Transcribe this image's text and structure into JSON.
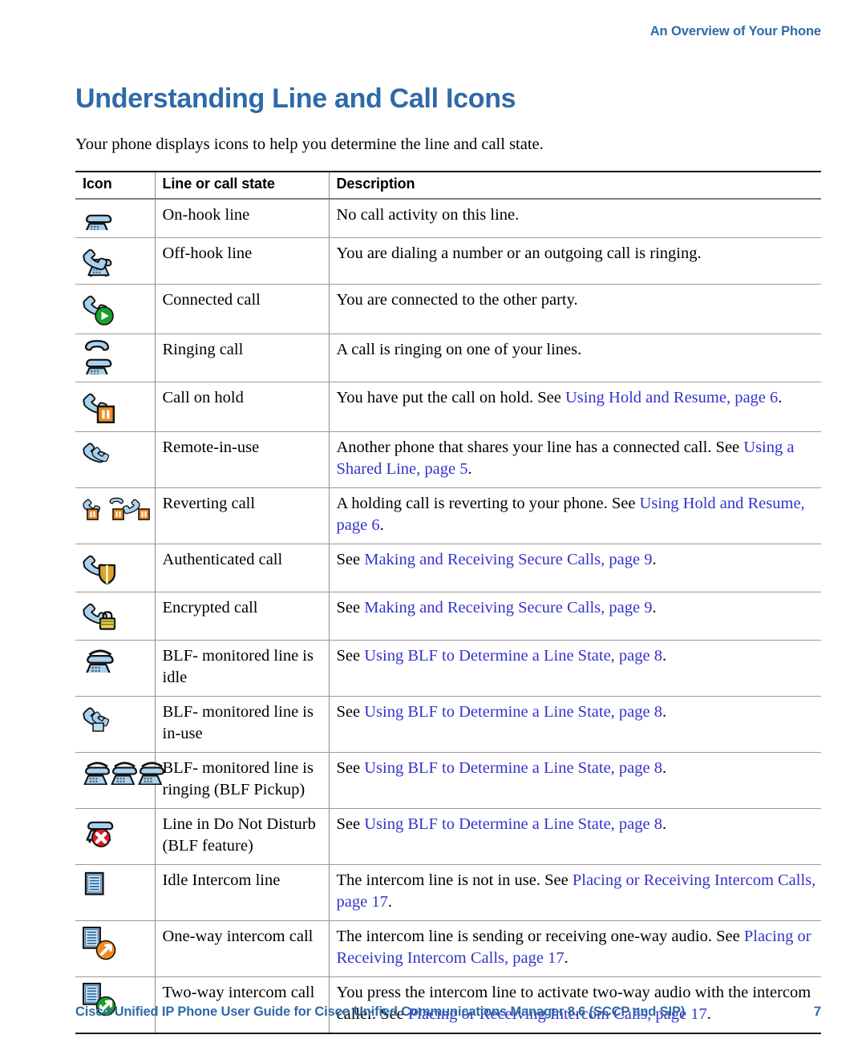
{
  "header": {
    "running_head": "An Overview of Your Phone"
  },
  "page": {
    "title": "Understanding Line and Call Icons",
    "intro": "Your phone displays icons to help you determine the line and call state."
  },
  "table": {
    "columns": [
      "Icon",
      "Line or call state",
      "Description"
    ],
    "rows": [
      {
        "icon": "on-hook-line-icon",
        "state": "On-hook line",
        "description_parts": [
          {
            "text": "No call activity on this line.",
            "link": false
          }
        ]
      },
      {
        "icon": "off-hook-line-icon",
        "state": "Off-hook line",
        "description_parts": [
          {
            "text": "You are dialing a number or an outgoing call is ringing.",
            "link": false
          }
        ]
      },
      {
        "icon": "connected-call-icon",
        "state": "Connected call",
        "description_parts": [
          {
            "text": "You are connected to the other party.",
            "link": false
          }
        ]
      },
      {
        "icon": "ringing-call-icon",
        "state": "Ringing call",
        "description_parts": [
          {
            "text": "A call is ringing on one of your lines.",
            "link": false
          }
        ]
      },
      {
        "icon": "call-on-hold-icon",
        "state": "Call on hold",
        "description_parts": [
          {
            "text": "You have put the call on hold. See ",
            "link": false
          },
          {
            "text": "Using Hold and Resume, page 6",
            "link": true
          },
          {
            "text": ".",
            "link": false
          }
        ]
      },
      {
        "icon": "remote-in-use-icon",
        "state": "Remote-in-use",
        "description_parts": [
          {
            "text": "Another phone that shares your line has a connected call. See ",
            "link": false
          },
          {
            "text": "Using a Shared Line, page 5",
            "link": true
          },
          {
            "text": ".",
            "link": false
          }
        ]
      },
      {
        "icon": "reverting-call-icon",
        "state": "Reverting call",
        "description_parts": [
          {
            "text": "A holding call is reverting to your phone. See ",
            "link": false
          },
          {
            "text": "Using Hold and Resume, page 6",
            "link": true
          },
          {
            "text": ".",
            "link": false
          }
        ]
      },
      {
        "icon": "authenticated-call-icon",
        "state": "Authenticated call",
        "description_parts": [
          {
            "text": "See ",
            "link": false
          },
          {
            "text": "Making and Receiving Secure Calls, page 9",
            "link": true
          },
          {
            "text": ".",
            "link": false
          }
        ]
      },
      {
        "icon": "encrypted-call-icon",
        "state": "Encrypted call",
        "description_parts": [
          {
            "text": "See ",
            "link": false
          },
          {
            "text": "Making and Receiving Secure Calls, page 9",
            "link": true
          },
          {
            "text": ".",
            "link": false
          }
        ]
      },
      {
        "icon": "blf-idle-line-icon",
        "state": "BLF- monitored line is idle",
        "description_parts": [
          {
            "text": "See ",
            "link": false
          },
          {
            "text": "Using BLF to Determine a Line State, page 8",
            "link": true
          },
          {
            "text": ".",
            "link": false
          }
        ]
      },
      {
        "icon": "blf-in-use-line-icon",
        "state": "BLF- monitored line is in-use",
        "description_parts": [
          {
            "text": "See ",
            "link": false
          },
          {
            "text": "Using BLF to Determine a Line State, page 8",
            "link": true
          },
          {
            "text": ".",
            "link": false
          }
        ]
      },
      {
        "icon": "blf-ringing-line-icon",
        "state": "BLF- monitored line is ringing (BLF Pickup)",
        "description_parts": [
          {
            "text": "See ",
            "link": false
          },
          {
            "text": "Using BLF to Determine a Line State, page 8",
            "link": true
          },
          {
            "text": ".",
            "link": false
          }
        ]
      },
      {
        "icon": "do-not-disturb-line-icon",
        "state": "Line in Do Not Disturb (BLF feature)",
        "description_parts": [
          {
            "text": "See ",
            "link": false
          },
          {
            "text": "Using BLF to Determine a Line State, page 8",
            "link": true
          },
          {
            "text": ".",
            "link": false
          }
        ]
      },
      {
        "icon": "idle-intercom-line-icon",
        "state": "Idle Intercom line",
        "description_parts": [
          {
            "text": "The intercom line is not in use. See ",
            "link": false
          },
          {
            "text": "Placing or Receiving Intercom Calls, page 17",
            "link": true
          },
          {
            "text": ".",
            "link": false
          }
        ]
      },
      {
        "icon": "one-way-intercom-call-icon",
        "state": "One-way intercom call",
        "description_parts": [
          {
            "text": "The intercom line is sending or receiving one-way audio. See ",
            "link": false
          },
          {
            "text": "Placing or Receiving Intercom Calls, page 17",
            "link": true
          },
          {
            "text": ".",
            "link": false
          }
        ]
      },
      {
        "icon": "two-way-intercom-call-icon",
        "state": "Two-way intercom call",
        "description_parts": [
          {
            "text": "You press the intercom line to activate two-way audio with the intercom caller. See ",
            "link": false
          },
          {
            "text": "Placing or Receiving Intercom Calls, page 17",
            "link": true
          },
          {
            "text": ".",
            "link": false
          }
        ]
      }
    ]
  },
  "footer": {
    "document_title": "Cisco Unified IP Phone User Guide for Cisco Unified Communications Manager 8.6 (SCCP and SIP)",
    "page_number": "7"
  },
  "colors": {
    "heading_blue": "#2e6aa8",
    "link_blue": "#3333cc",
    "phone_blue": "#a8d2f0",
    "hold_orange": "#f08a22",
    "connected_green": "#1a9e2e",
    "dnd_red": "#e01b24"
  }
}
